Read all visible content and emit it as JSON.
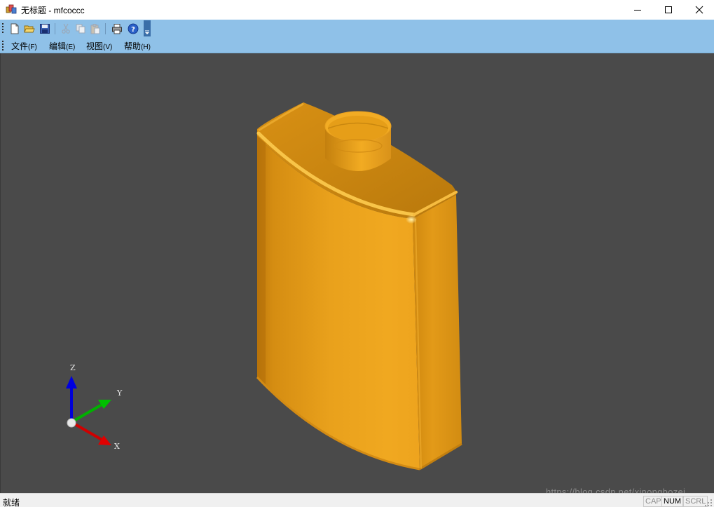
{
  "window": {
    "title": "无标题 - mfcoccc",
    "app_icon": "mfc-document-icon",
    "controls": [
      "minimize-icon",
      "maximize-icon",
      "close-icon"
    ]
  },
  "toolbar": {
    "buttons": [
      {
        "name": "new-button",
        "icon": "new-document-icon",
        "enabled": true
      },
      {
        "name": "open-button",
        "icon": "open-folder-icon",
        "enabled": true
      },
      {
        "name": "save-button",
        "icon": "floppy-disk-icon",
        "enabled": true
      },
      {
        "name": "cut-button",
        "icon": "scissors-icon",
        "enabled": false
      },
      {
        "name": "copy-button",
        "icon": "copy-icon",
        "enabled": false
      },
      {
        "name": "paste-button",
        "icon": "clipboard-icon",
        "enabled": false
      },
      {
        "name": "print-button",
        "icon": "printer-icon",
        "enabled": true
      },
      {
        "name": "help-button",
        "icon": "question-circle-icon",
        "enabled": true
      }
    ]
  },
  "menu": {
    "items": [
      {
        "label": "文件",
        "accel": "(F)"
      },
      {
        "label": "编辑",
        "accel": "(E)"
      },
      {
        "label": "视图",
        "accel": "(V)"
      },
      {
        "label": "帮助",
        "accel": "(H)"
      }
    ]
  },
  "viewport": {
    "background": "#4a4a4a",
    "model_color": "#f0a820",
    "axes": {
      "z_label": "Z",
      "y_label": "Y",
      "x_label": "X",
      "z_color": "#0000e0",
      "y_color": "#00c000",
      "x_color": "#e00000"
    },
    "watermark": "https://blog.csdn.net/xinongbozei"
  },
  "status": {
    "text": "就绪",
    "indicators": [
      {
        "label": "CAP",
        "active": false
      },
      {
        "label": "NUM",
        "active": true
      },
      {
        "label": "SCRL",
        "active": false
      }
    ]
  }
}
